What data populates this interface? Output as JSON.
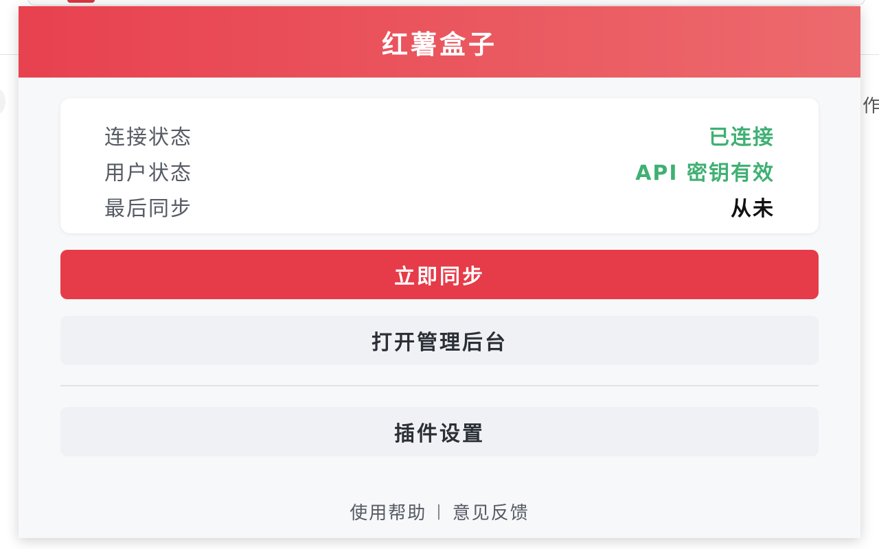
{
  "background": {
    "right_partial_text": "作"
  },
  "popup": {
    "title": "红薯盒子",
    "status": [
      {
        "label": "连接状态",
        "value": "已连接",
        "color": "#3fb073"
      },
      {
        "label": "用户状态",
        "value": "API 密钥有效",
        "color": "#3fb073"
      },
      {
        "label": "最后同步",
        "value": "从未",
        "color": "#111111"
      }
    ],
    "buttons": {
      "sync_now": "立即同步",
      "open_admin": "打开管理后台",
      "plugin_settings": "插件设置"
    },
    "footer": {
      "help": "使用帮助",
      "separator": "|",
      "feedback": "意见反馈"
    }
  },
  "colors": {
    "brand_red": "#e63b48",
    "header_gradient_start": "#e8414f",
    "header_gradient_end": "#ec6a6d",
    "success_green": "#3fb073"
  }
}
